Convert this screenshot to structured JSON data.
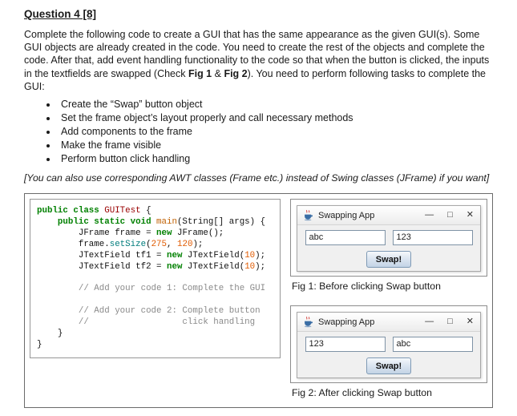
{
  "doc": {
    "title": "Question 4 [8]",
    "intro": [
      {
        "t": "Complete the following code to create a GUI that has the same appearance as the given GUI(s). Some GUI objects are already created in the code. You need to create the rest of the objects and complete the code. After that, add event handling functionality to the code so that when the button is clicked, the inputs in the textfields are swapped (Check ",
        "b": false
      },
      {
        "t": "Fig 1",
        "b": true
      },
      {
        "t": " & ",
        "b": false
      },
      {
        "t": "Fig 2",
        "b": true
      },
      {
        "t": "). You need to perform following tasks to complete the GUI:",
        "b": false
      }
    ],
    "bullets": [
      "Create the “Swap” button object",
      "Set the frame object’s layout properly and call necessary methods",
      "Add components to the frame",
      "Make the frame visible",
      "Perform button click handling"
    ],
    "note": "[You can also use corresponding AWT classes (Frame etc.) instead of Swing classes (JFrame) if you want]"
  },
  "code": {
    "lines": [
      [
        {
          "t": "public class ",
          "c": "kw"
        },
        {
          "t": "GUITest",
          "c": "cls"
        },
        {
          "t": " {",
          "c": "pl"
        }
      ],
      [
        {
          "t": "    ",
          "c": "pl"
        },
        {
          "t": "public static void ",
          "c": "kw"
        },
        {
          "t": "main",
          "c": "fn"
        },
        {
          "t": "(String[] args) {",
          "c": "pl"
        }
      ],
      [
        {
          "t": "        JFrame frame = ",
          "c": "pl"
        },
        {
          "t": "new",
          "c": "kw"
        },
        {
          "t": " JFrame();",
          "c": "pl"
        }
      ],
      [
        {
          "t": "        frame.",
          "c": "pl"
        },
        {
          "t": "setSize",
          "c": "meth"
        },
        {
          "t": "(",
          "c": "pl"
        },
        {
          "t": "275",
          "c": "num"
        },
        {
          "t": ", ",
          "c": "pl"
        },
        {
          "t": "120",
          "c": "num"
        },
        {
          "t": ");",
          "c": "pl"
        }
      ],
      [
        {
          "t": "        JTextField tf1 = ",
          "c": "pl"
        },
        {
          "t": "new",
          "c": "kw"
        },
        {
          "t": " JTextField(",
          "c": "pl"
        },
        {
          "t": "10",
          "c": "num"
        },
        {
          "t": ");",
          "c": "pl"
        }
      ],
      [
        {
          "t": "        JTextField tf2 = ",
          "c": "pl"
        },
        {
          "t": "new",
          "c": "kw"
        },
        {
          "t": " JTextField(",
          "c": "pl"
        },
        {
          "t": "10",
          "c": "num"
        },
        {
          "t": ");",
          "c": "pl"
        }
      ],
      [],
      [
        {
          "t": "        // Add your code 1: Complete the GUI",
          "c": "cm"
        }
      ],
      [],
      [
        {
          "t": "        // Add your code 2: Complete button",
          "c": "cm"
        }
      ],
      [
        {
          "t": "        //                  click handling",
          "c": "cm"
        }
      ],
      [
        {
          "t": "    }",
          "c": "pl"
        }
      ],
      [
        {
          "t": "}",
          "c": "pl"
        }
      ]
    ]
  },
  "figs": [
    {
      "window_title": "Swapping App",
      "controls": {
        "minimize": "—",
        "maximize": "□",
        "close": "✕"
      },
      "tf_left": "abc",
      "tf_right": "123",
      "button": "Swap!",
      "caption": "Fig 1: Before clicking Swap button"
    },
    {
      "window_title": "Swapping App",
      "controls": {
        "minimize": "—",
        "maximize": "□",
        "close": "✕"
      },
      "tf_left": "123",
      "tf_right": "abc",
      "button": "Swap!",
      "caption": "Fig 2: After clicking Swap button"
    }
  ]
}
